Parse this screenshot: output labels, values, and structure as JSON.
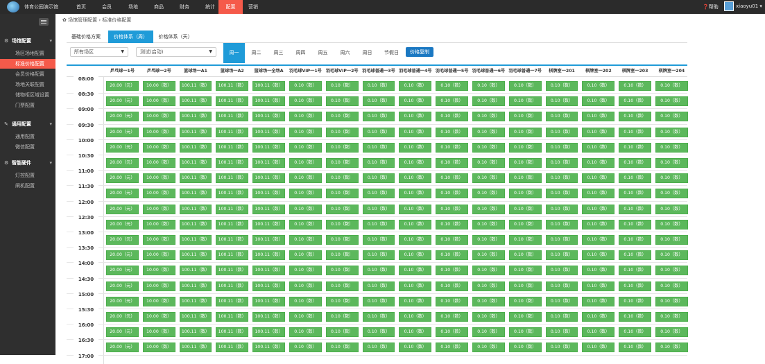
{
  "topbar": {
    "app_title": "体育公园演示馆",
    "nav": [
      "首页",
      "会员",
      "场地",
      "商品",
      "财务",
      "统计",
      "配置",
      "营销"
    ],
    "active_nav": 6,
    "help_label": "帮助",
    "username": "xiaoyu01"
  },
  "sidebar": {
    "groups": [
      {
        "label": "场馆配置",
        "items": [
          "场区场地配置",
          "标准价格配置",
          "会员价格配置",
          "场地关联配置",
          "储物柜区域设置",
          "门票配置"
        ]
      },
      {
        "label": "通用配置",
        "items": [
          "通用配置",
          "微信配置"
        ]
      },
      {
        "label": "智能硬件",
        "items": [
          "灯控配置",
          "闸机配置"
        ]
      }
    ],
    "active_item": "标准价格配置"
  },
  "breadcrumb": "场馆管理配置 › 标准价格配置",
  "tabs": [
    "基础价格方案",
    "价格体系（周）",
    "价格体系（天）"
  ],
  "active_tab": 1,
  "filters": {
    "area_select": "所有场区",
    "plan_select": "测试(启动)"
  },
  "days": [
    "周一",
    "周二",
    "周三",
    "周四",
    "周五",
    "周六",
    "周日",
    "节假日"
  ],
  "active_day": 0,
  "copy_button": "价格复制",
  "columns": [
    "乒乓球一1号",
    "乒乓球一2号",
    "篮球场一A1",
    "篮球场一A2",
    "篮球场一全场A",
    "羽毛球VIP一1号",
    "羽毛球VIP一2号",
    "羽毛球普通一3号",
    "羽毛球普通一4号",
    "羽毛球普通一5号",
    "羽毛球普通一6号",
    "羽毛球普通一7号",
    "棋牌室一201",
    "棋牌室一202",
    "棋牌室一203",
    "棋牌室一204"
  ],
  "cell_values": [
    "20.00（元）",
    "10.00（数）",
    "100.11（数）",
    "100.11（数）",
    "100.11（数）",
    "0.10（数）",
    "0.10（数）",
    "0.10（数）",
    "0.10（数）",
    "0.10（数）",
    "0.10（数）",
    "0.10（数）",
    "0.10（数）",
    "0.10（数）",
    "0.10（数）",
    "0.10（数）"
  ],
  "times": [
    "08:00",
    "08:30",
    "09:00",
    "09:30",
    "10:00",
    "10:30",
    "11:00",
    "11:30",
    "12:00",
    "12:30",
    "13:00",
    "13:30",
    "14:00",
    "14:30",
    "15:00",
    "15:30",
    "16:00",
    "16:30",
    "17:00"
  ],
  "colors": {
    "accent": "#1f9bd8",
    "active_red": "#f55a4a",
    "cell_green": "#5cb85c",
    "copy_blue": "#1a78c2"
  }
}
